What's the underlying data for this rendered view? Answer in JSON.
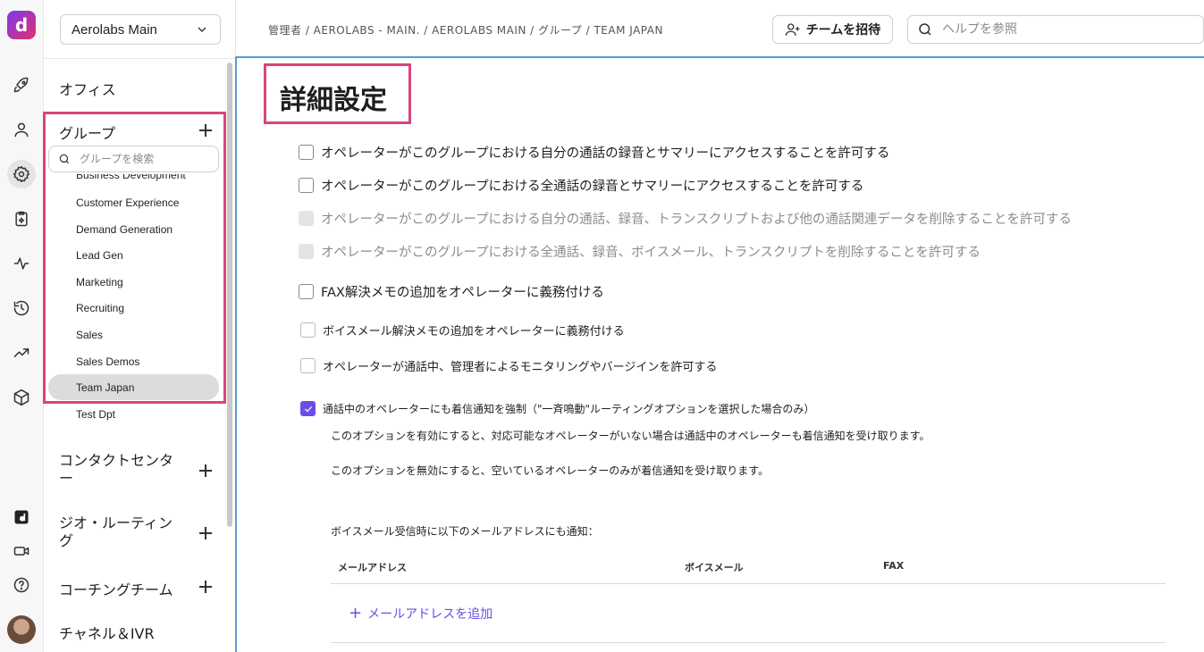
{
  "sidebar": {
    "workspace": "Aerolabs Main",
    "sections": {
      "office": "オフィス",
      "groups": "グループ",
      "contact_center": "コンタクトセンター",
      "geo_routing": "ジオ・ルーティング",
      "coaching_team": "コーチングチーム",
      "channels_ivr": "チャネル＆IVR"
    },
    "group_search_placeholder": "グループを検索",
    "groups": [
      {
        "label": "Business Development"
      },
      {
        "label": "Customer Experience"
      },
      {
        "label": "Demand Generation"
      },
      {
        "label": "Lead Gen"
      },
      {
        "label": "Marketing"
      },
      {
        "label": "Recruiting"
      },
      {
        "label": "Sales"
      },
      {
        "label": "Sales Demos"
      },
      {
        "label": "Team Japan",
        "selected": true
      },
      {
        "label": "Test Dpt"
      }
    ]
  },
  "rail": {
    "icons": [
      "rocket-icon",
      "user-icon",
      "gear-icon",
      "clipboard-ai-icon",
      "activity-icon",
      "history-icon",
      "trending-icon",
      "cube-icon",
      "dialpad-ai-icon",
      "video-icon",
      "help-icon"
    ]
  },
  "header": {
    "breadcrumb": "管理者 / AEROLABS - MAIN. / AEROLABS MAIN / グループ / TEAM JAPAN",
    "invite_label": "チームを招待",
    "help_placeholder": "ヘルプを参照"
  },
  "main": {
    "title": "詳細設定",
    "options": [
      {
        "label": "オペレーターがこのグループにおける自分の通話の録音とサマリーにアクセスすることを許可する",
        "checked": false,
        "disabled": false
      },
      {
        "label": "オペレーターがこのグループにおける全通話の録音とサマリーにアクセスすることを許可する",
        "checked": false,
        "disabled": false
      },
      {
        "label": "オペレーターがこのグループにおける自分の通話、録音、トランスクリプトおよび他の通話関連データを削除することを許可する",
        "checked": false,
        "disabled": true
      },
      {
        "label": "オペレーターがこのグループにおける全通話、録音、ボイスメール、トランスクリプトを削除することを許可する",
        "checked": false,
        "disabled": true
      },
      {
        "label": "FAX解決メモの追加をオペレーターに義務付ける",
        "checked": false,
        "disabled": false
      },
      {
        "label": "ボイスメール解決メモの追加をオペレーターに義務付ける",
        "checked": false,
        "disabled": false
      },
      {
        "label": "オペレーターが通話中、管理者によるモニタリングやバージインを許可する",
        "checked": false,
        "disabled": false
      },
      {
        "label": "通話中のオペレーターにも着信通知を強制（\"一斉鳴動\"ルーティングオプションを選択した場合のみ）",
        "checked": true,
        "disabled": false
      }
    ],
    "desc_enabled": "このオプションを有効にすると、対応可能なオペレーターがいない場合は通話中のオペレーターも着信通知を受け取ります。",
    "desc_disabled": "このオプションを無効にすると、空いているオペレーターのみが着信通知を受け取ります。",
    "notify_label": "ボイスメール受信時に以下のメールアドレスにも通知：",
    "table_headers": {
      "email": "メールアドレス",
      "voicemail": "ボイスメール",
      "fax": "FAX"
    },
    "add_email": "メールアドレスを追加",
    "accent_color": "#6a4de8",
    "highlight_color": "#d6457f"
  }
}
